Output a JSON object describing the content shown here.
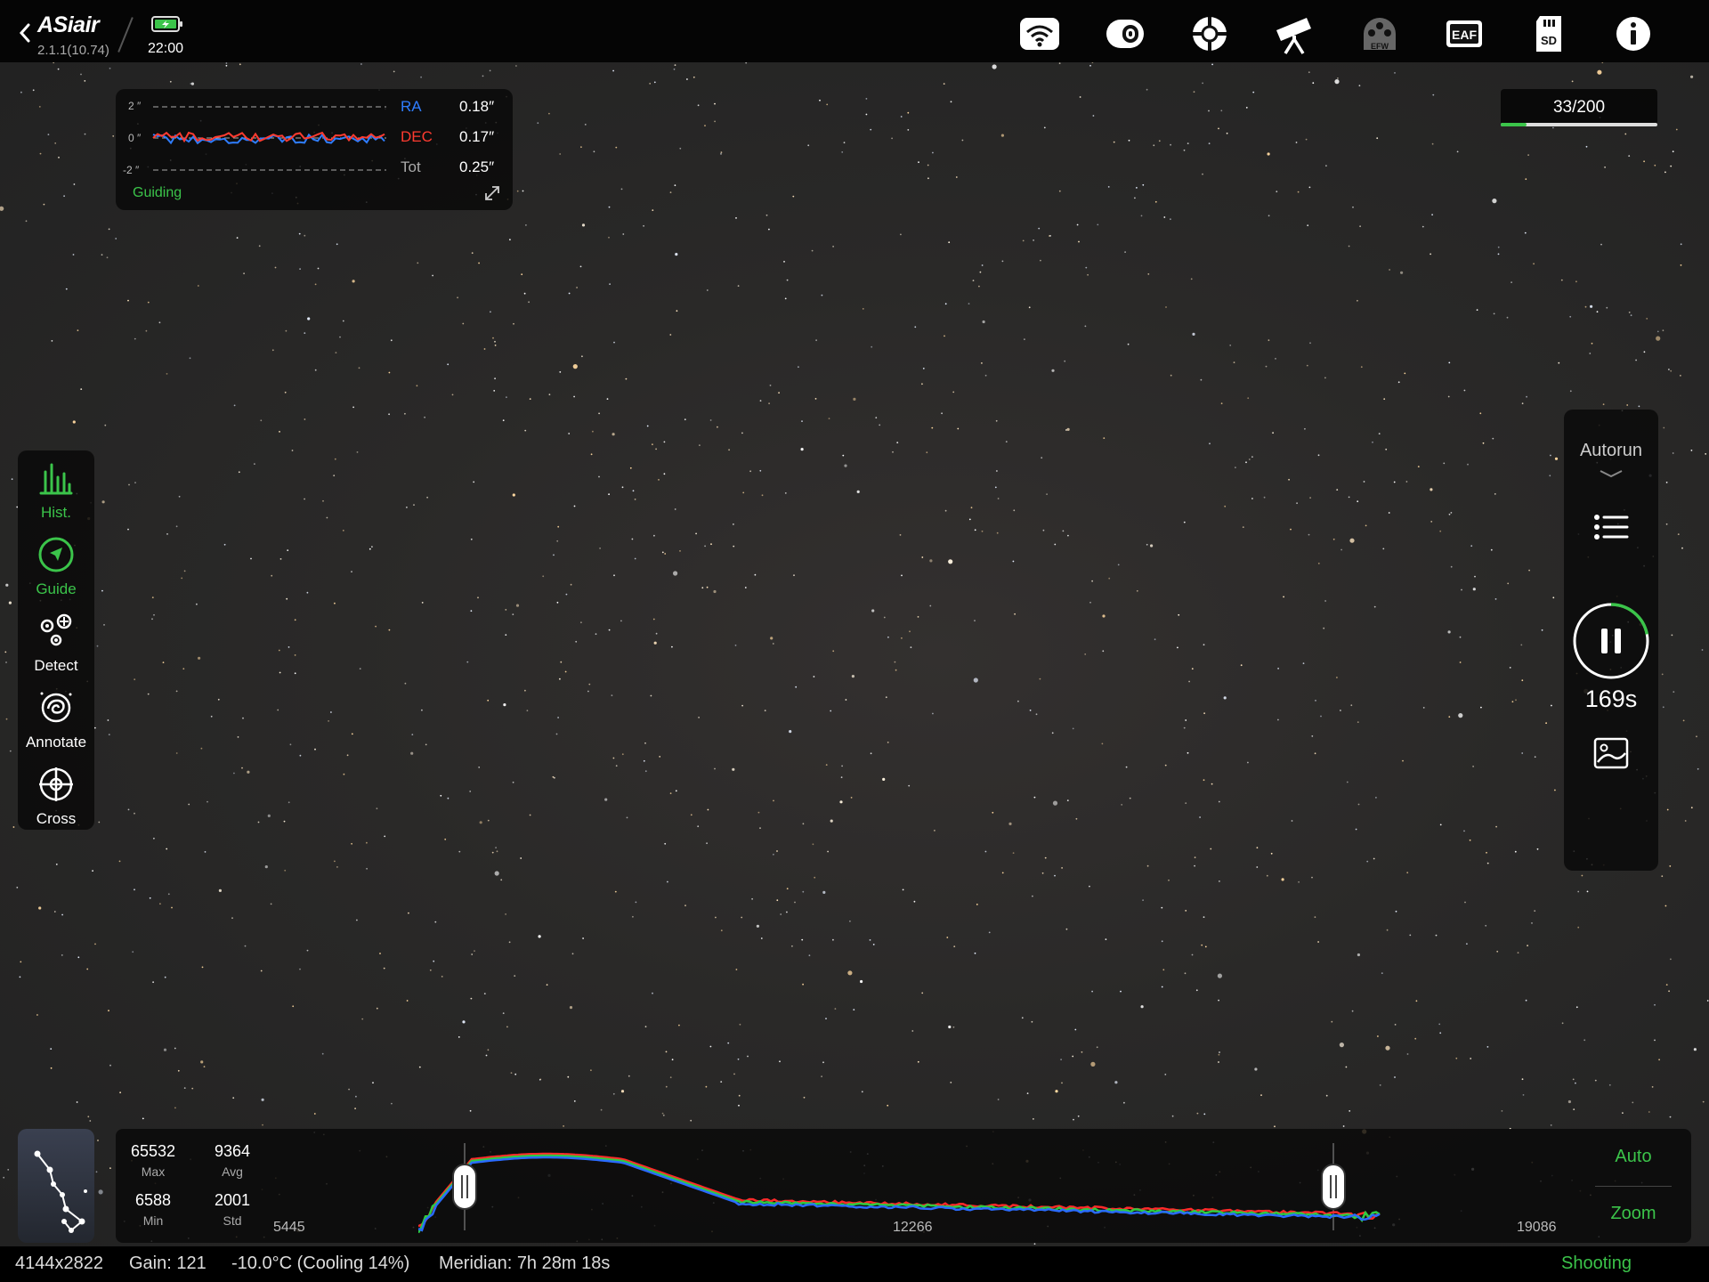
{
  "app": {
    "logo": "ASiair",
    "version": "2.1.1(10.74)",
    "time": "22:00"
  },
  "toolbar_icons": [
    "wifi-icon",
    "camera-icon",
    "guide-scope-icon",
    "telescope-icon",
    "efw-icon",
    "eaf-icon",
    "sd-card-icon",
    "info-icon"
  ],
  "icon_labels": {
    "efw": "EFW",
    "eaf": "EAF",
    "sd": "SD"
  },
  "guiding": {
    "ticks": [
      "2 ″",
      "0 ″",
      "-2 ″"
    ],
    "rows": [
      {
        "name": "RA",
        "value": "0.18″",
        "color": "#2f7dff"
      },
      {
        "name": "DEC",
        "value": "0.17″",
        "color": "#ff3b30"
      },
      {
        "name": "Tot",
        "value": "0.25″",
        "color": "#aaaaaa"
      }
    ],
    "label": "Guiding"
  },
  "sequence": {
    "counter": "33/200",
    "progress": 0.165
  },
  "left_tools": [
    {
      "id": "hist",
      "label": "Hist.",
      "active": true
    },
    {
      "id": "guide",
      "label": "Guide",
      "active": true
    },
    {
      "id": "detect",
      "label": "Detect",
      "active": false
    },
    {
      "id": "annotate",
      "label": "Annotate",
      "active": false
    },
    {
      "id": "cross",
      "label": "Cross",
      "active": false
    }
  ],
  "autorun": {
    "label": "Autorun",
    "countdown": "169s",
    "exposure_progress": 0.22
  },
  "histogram": {
    "stats": [
      {
        "value": "65532",
        "label": "Max"
      },
      {
        "value": "9364",
        "label": "Avg"
      },
      {
        "value": "6588",
        "label": "Min"
      },
      {
        "value": "2001",
        "label": "Std"
      }
    ],
    "axis": [
      "5445",
      "12266",
      "19086"
    ],
    "auto_label": "Auto",
    "zoom_label": "Zoom"
  },
  "status": {
    "resolution": "4144x2822",
    "gain": "Gain: 121",
    "temperature": "-10.0°C (Cooling 14%)",
    "meridian": "Meridian: 7h 28m 18s",
    "mode": "Shooting"
  },
  "colors": {
    "accent_green": "#3bc44a",
    "ra_blue": "#2f7dff",
    "dec_red": "#ff3b30",
    "panel_bg": "#080808",
    "sky_bg": "#2a2928"
  }
}
